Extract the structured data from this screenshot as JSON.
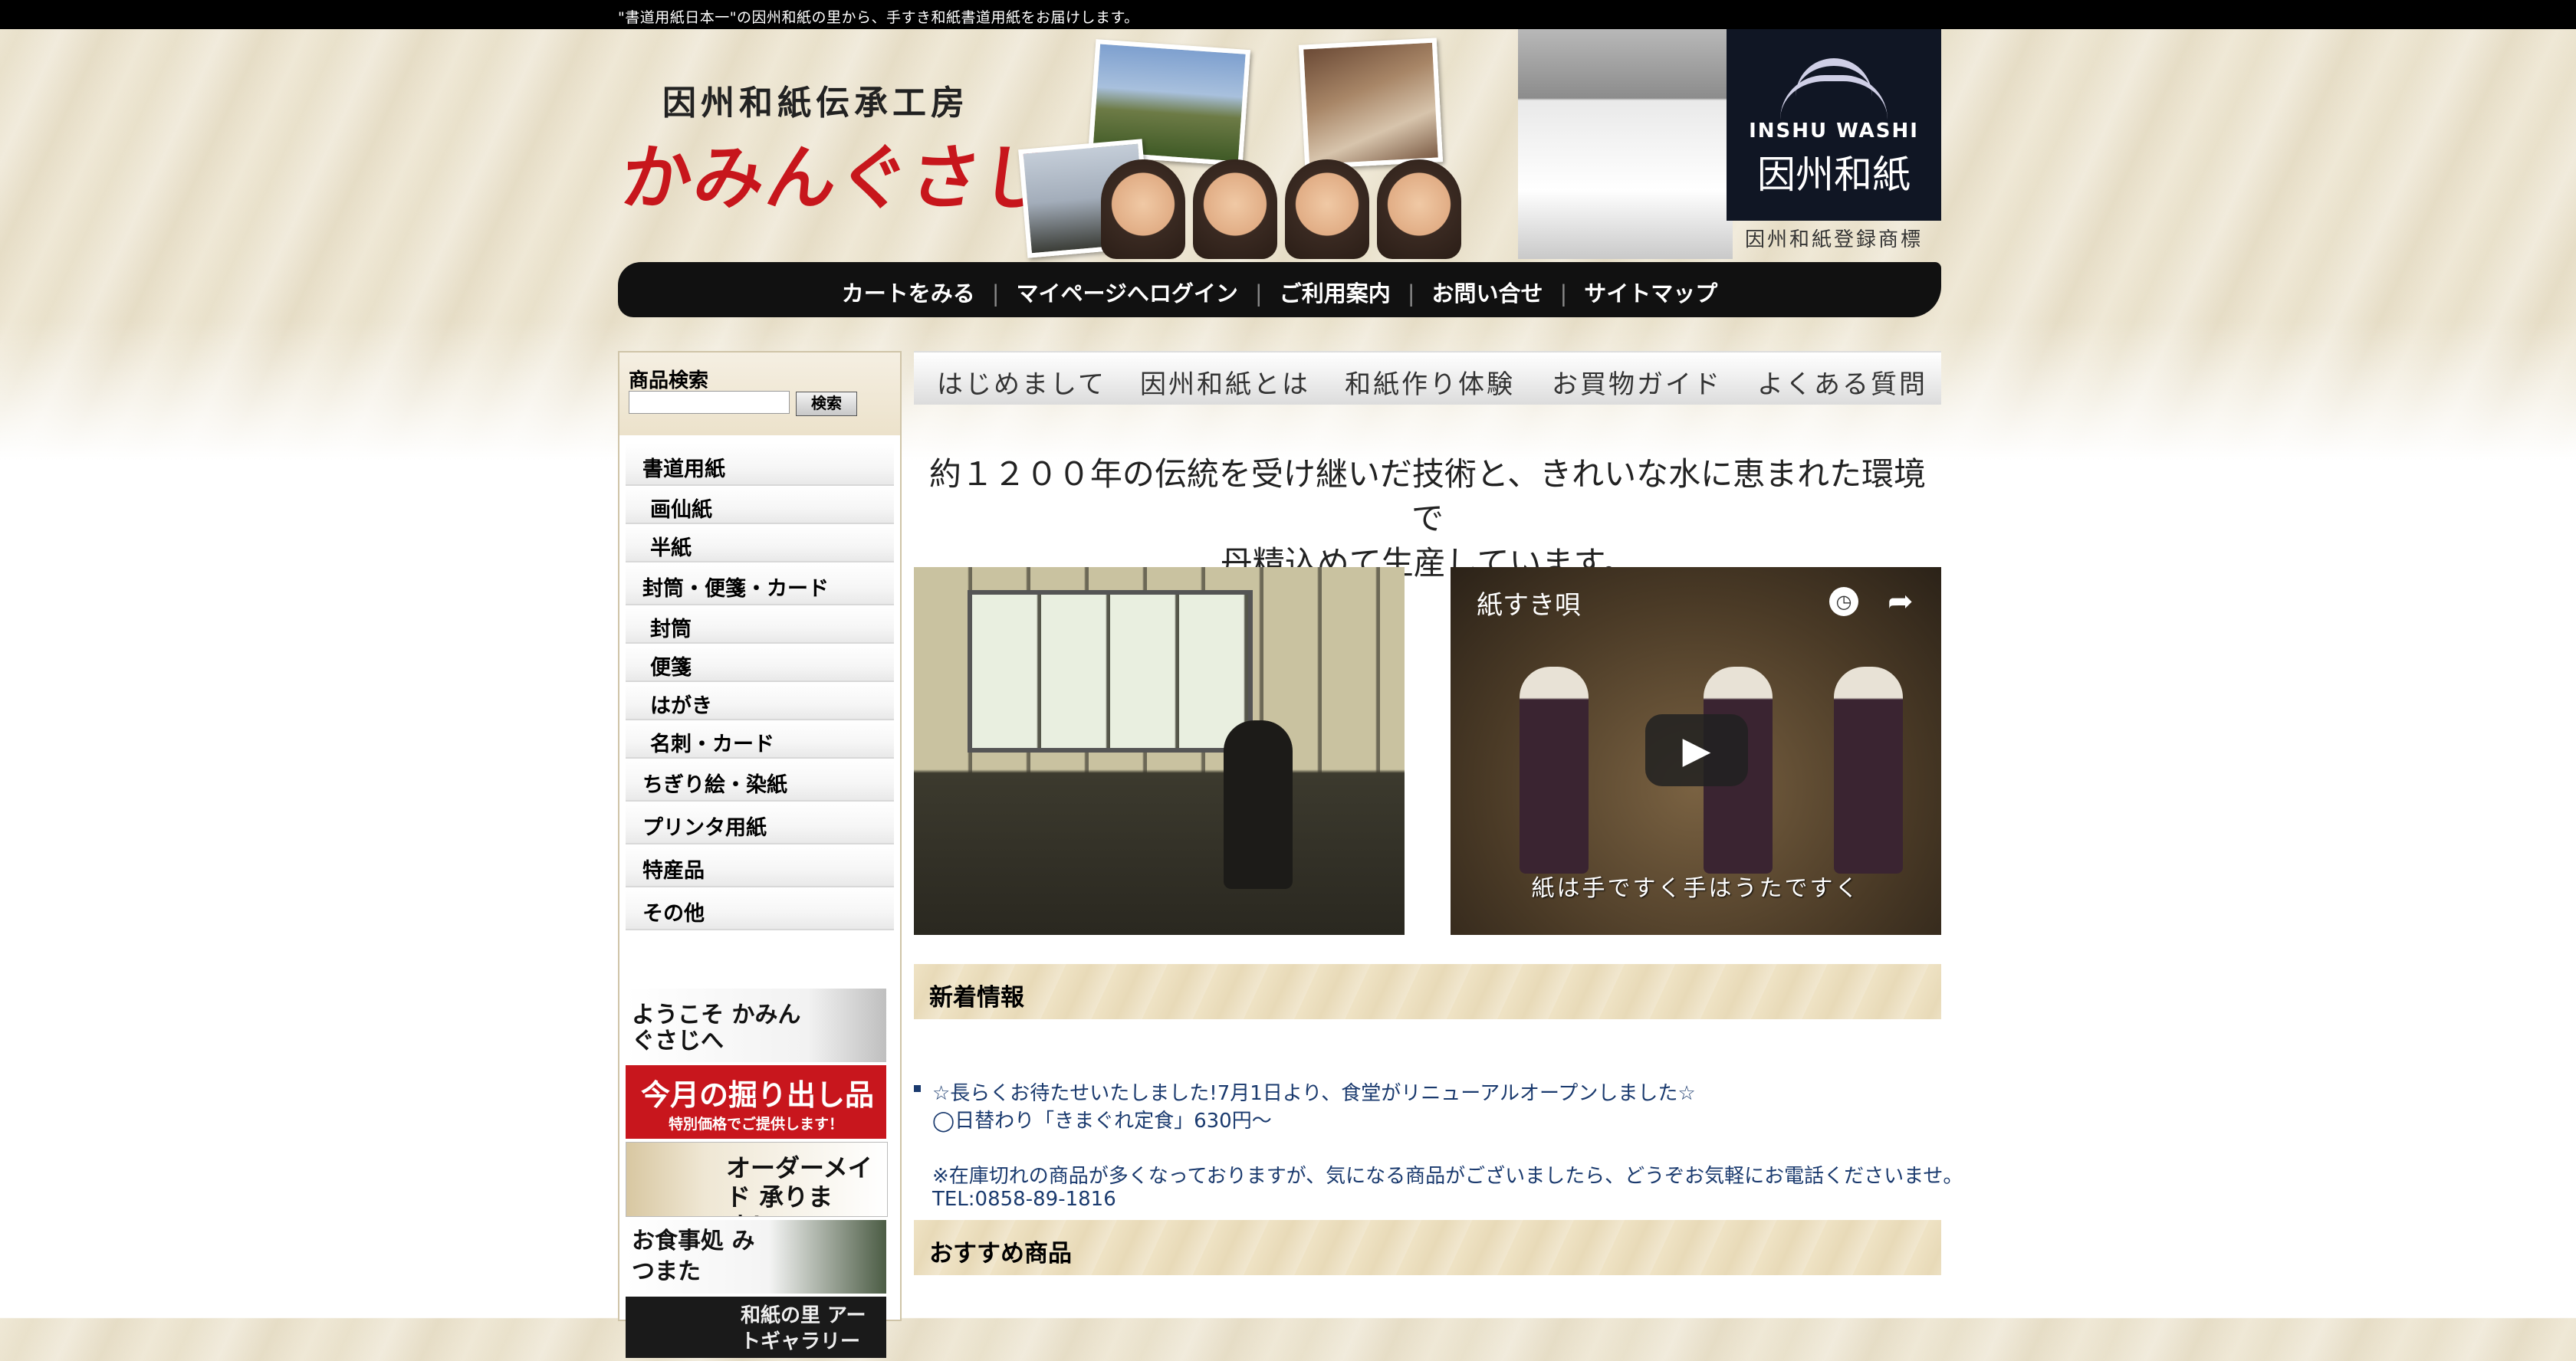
{
  "topbar": {
    "tagline": "\"書道用紙日本一\"の因州和紙の里から、手すき和紙書道用紙をお届けします。"
  },
  "header": {
    "logo_sub": "因州和紙伝承工房",
    "logo_main": "かみんぐさじ",
    "badge_en": "INSHU WASHI",
    "badge_jp": "因州和紙",
    "trademark": "因州和紙登録商標"
  },
  "nav": {
    "items": [
      {
        "label": "カートをみる"
      },
      {
        "label": "マイページへログイン"
      },
      {
        "label": "ご利用案内"
      },
      {
        "label": "お問い合せ"
      },
      {
        "label": "サイトマップ"
      }
    ]
  },
  "sidebar": {
    "search_label": "商品検索",
    "search_value": "",
    "search_button": "検索",
    "categories": [
      {
        "label": "書道用紙"
      },
      {
        "label": "画仙紙"
      },
      {
        "label": "半紙"
      },
      {
        "label": "封筒・便箋・カード"
      },
      {
        "label": "封筒"
      },
      {
        "label": "便箋"
      },
      {
        "label": "はがき"
      },
      {
        "label": "名刺・カード"
      },
      {
        "label": "ちぎり絵・染紙"
      },
      {
        "label": "プリンタ用紙"
      },
      {
        "label": "特産品"
      },
      {
        "label": "その他"
      }
    ],
    "banners": [
      {
        "text": "ようこそ かみんぐさじへ"
      },
      {
        "text": "今月の掘り出し品",
        "sub": "特別価格でご提供します！"
      },
      {
        "text": "オーダーメイド 承ります！"
      },
      {
        "text": "お食事処 みつまた"
      },
      {
        "text": "和紙の里 アートギャラリー"
      }
    ]
  },
  "main": {
    "menu": [
      {
        "label": "はじめまして"
      },
      {
        "label": "因州和紙とは"
      },
      {
        "label": "和紙作り体験"
      },
      {
        "label": "お買物ガイド"
      },
      {
        "label": "よくある質問"
      }
    ],
    "headline_1": "約１２００年の伝統を受け継いだ技術と、きれいな水に恵まれた環境で",
    "headline_2": "丹精込めて生産しています。",
    "video": {
      "title": "紙すき唄",
      "caption": "紙は手ですく手はうたですく"
    },
    "news_heading": "新着情報",
    "news_lines": [
      "☆長らくお待たせいたしました!7月1日より、食堂がリニューアルオープンしました☆",
      "◯日替わり「きまぐれ定食」630円〜",
      "※在庫切れの商品が多くなっておりますが、気になる商品がございましたら、どうぞお気軽にお電話くださいませ。",
      "TEL:0858-89-1816"
    ],
    "recommend_heading": "おすすめ商品"
  },
  "colors": {
    "brand_red": "#c7161c",
    "nav_bg": "#111111",
    "news_text": "#1a3a6e"
  }
}
